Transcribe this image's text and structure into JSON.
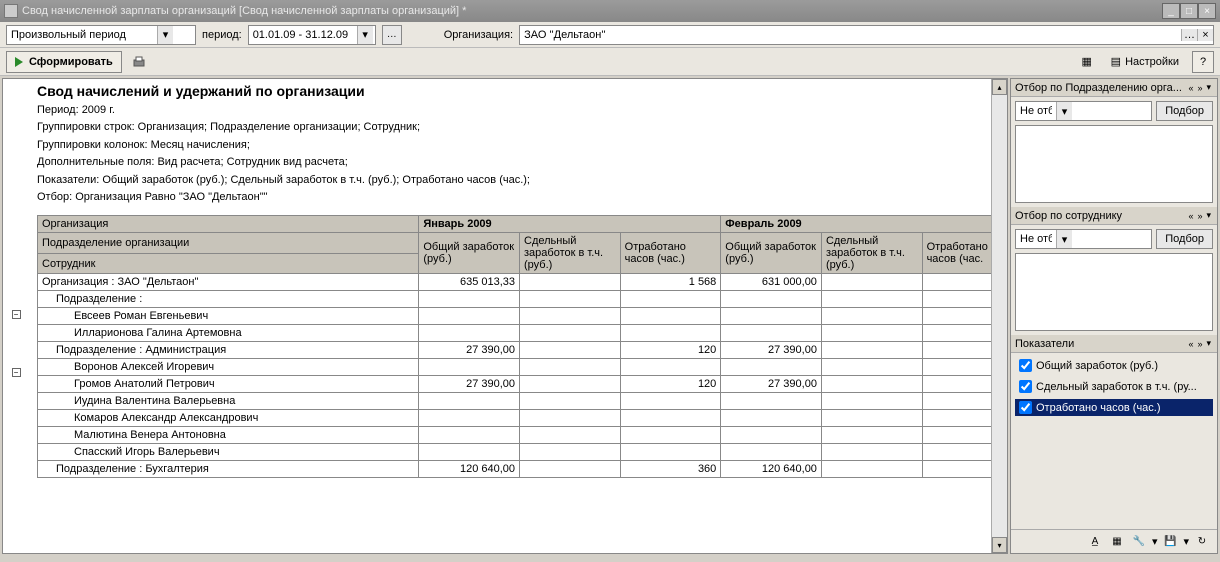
{
  "window": {
    "title": "Свод начисленной зарплаты организаций [Свод начисленной зарплаты организаций] *"
  },
  "toolbar": {
    "period_type": "Произвольный период",
    "period_label": "период:",
    "period_value": "01.01.09 - 31.12.09",
    "org_label": "Организация:",
    "org_value": "ЗАО ''Дельтаон''",
    "form_label": "Сформировать",
    "settings_label": "Настройки"
  },
  "report": {
    "title": "Свод начислений и удержаний по организации",
    "meta": [
      "Период: 2009 г.",
      "Группировки строк: Организация; Подразделение организации; Сотрудник;",
      "Группировки колонок: Месяц начисления;",
      "Дополнительные поля: Вид расчета; Сотрудник вид расчета;",
      "Показатели: Общий заработок (руб.); Сдельный заработок в т.ч. (руб.); Отработано часов (час.);",
      "Отбор: Организация Равно \"ЗАО \"Дельтаон\"\""
    ],
    "columns": {
      "c1": "Организация",
      "c2": "Подразделение организации",
      "c3": "Сотрудник",
      "m1": "Январь 2009",
      "m2": "Февраль 2009",
      "sub1": "Общий заработок (руб.)",
      "sub2": "Сдельный заработок в т.ч. (руб.)",
      "sub3": "Отработано часов (час.)",
      "sub4": "Общий заработок (руб.)",
      "sub5": "Сдельный заработок в т.ч. (руб.)",
      "sub6": "Отработано часов (час."
    },
    "rows": [
      {
        "label": "Организация : ЗАО \"Дельтаон\"",
        "v1": "635 013,33",
        "v2": "",
        "v3": "1 568",
        "v4": "631 000,00",
        "v5": "",
        "v6": "",
        "indent": 0
      },
      {
        "label": "Подразделение :",
        "v1": "",
        "v2": "",
        "v3": "",
        "v4": "",
        "v5": "",
        "v6": "",
        "indent": 1
      },
      {
        "label": "Евсеев Роман Евгеньевич",
        "v1": "",
        "v2": "",
        "v3": "",
        "v4": "",
        "v5": "",
        "v6": "",
        "indent": 2
      },
      {
        "label": "Илларионова Галина Артемовна",
        "v1": "",
        "v2": "",
        "v3": "",
        "v4": "",
        "v5": "",
        "v6": "",
        "indent": 2
      },
      {
        "label": "Подразделение : Администрация",
        "v1": "27 390,00",
        "v2": "",
        "v3": "120",
        "v4": "27 390,00",
        "v5": "",
        "v6": "",
        "indent": 1
      },
      {
        "label": "Воронов Алексей Игоревич",
        "v1": "",
        "v2": "",
        "v3": "",
        "v4": "",
        "v5": "",
        "v6": "",
        "indent": 2
      },
      {
        "label": "Громов Анатолий Петрович",
        "v1": "27 390,00",
        "v2": "",
        "v3": "120",
        "v4": "27 390,00",
        "v5": "",
        "v6": "",
        "indent": 2
      },
      {
        "label": "Иудина Валентина Валерьевна",
        "v1": "",
        "v2": "",
        "v3": "",
        "v4": "",
        "v5": "",
        "v6": "",
        "indent": 2
      },
      {
        "label": "Комаров Александр Александрович",
        "v1": "",
        "v2": "",
        "v3": "",
        "v4": "",
        "v5": "",
        "v6": "",
        "indent": 2
      },
      {
        "label": "Малютина Венера Антоновна",
        "v1": "",
        "v2": "",
        "v3": "",
        "v4": "",
        "v5": "",
        "v6": "",
        "indent": 2
      },
      {
        "label": "Спасский Игорь Валерьевич",
        "v1": "",
        "v2": "",
        "v3": "",
        "v4": "",
        "v5": "",
        "v6": "",
        "indent": 2
      },
      {
        "label": "Подразделение : Бухгалтерия",
        "v1": "120 640,00",
        "v2": "",
        "v3": "360",
        "v4": "120 640,00",
        "v5": "",
        "v6": "",
        "indent": 1
      }
    ]
  },
  "side": {
    "p1_title": "Отбор по Подразделению орга...",
    "p2_title": "Отбор по сотруднику",
    "p3_title": "Показатели",
    "not_sel": "Не отби",
    "pick": "Подбор",
    "ind1": "Общий заработок (руб.)",
    "ind2": "Сдельный заработок в т.ч. (ру...",
    "ind3": "Отработано часов (час.)"
  }
}
